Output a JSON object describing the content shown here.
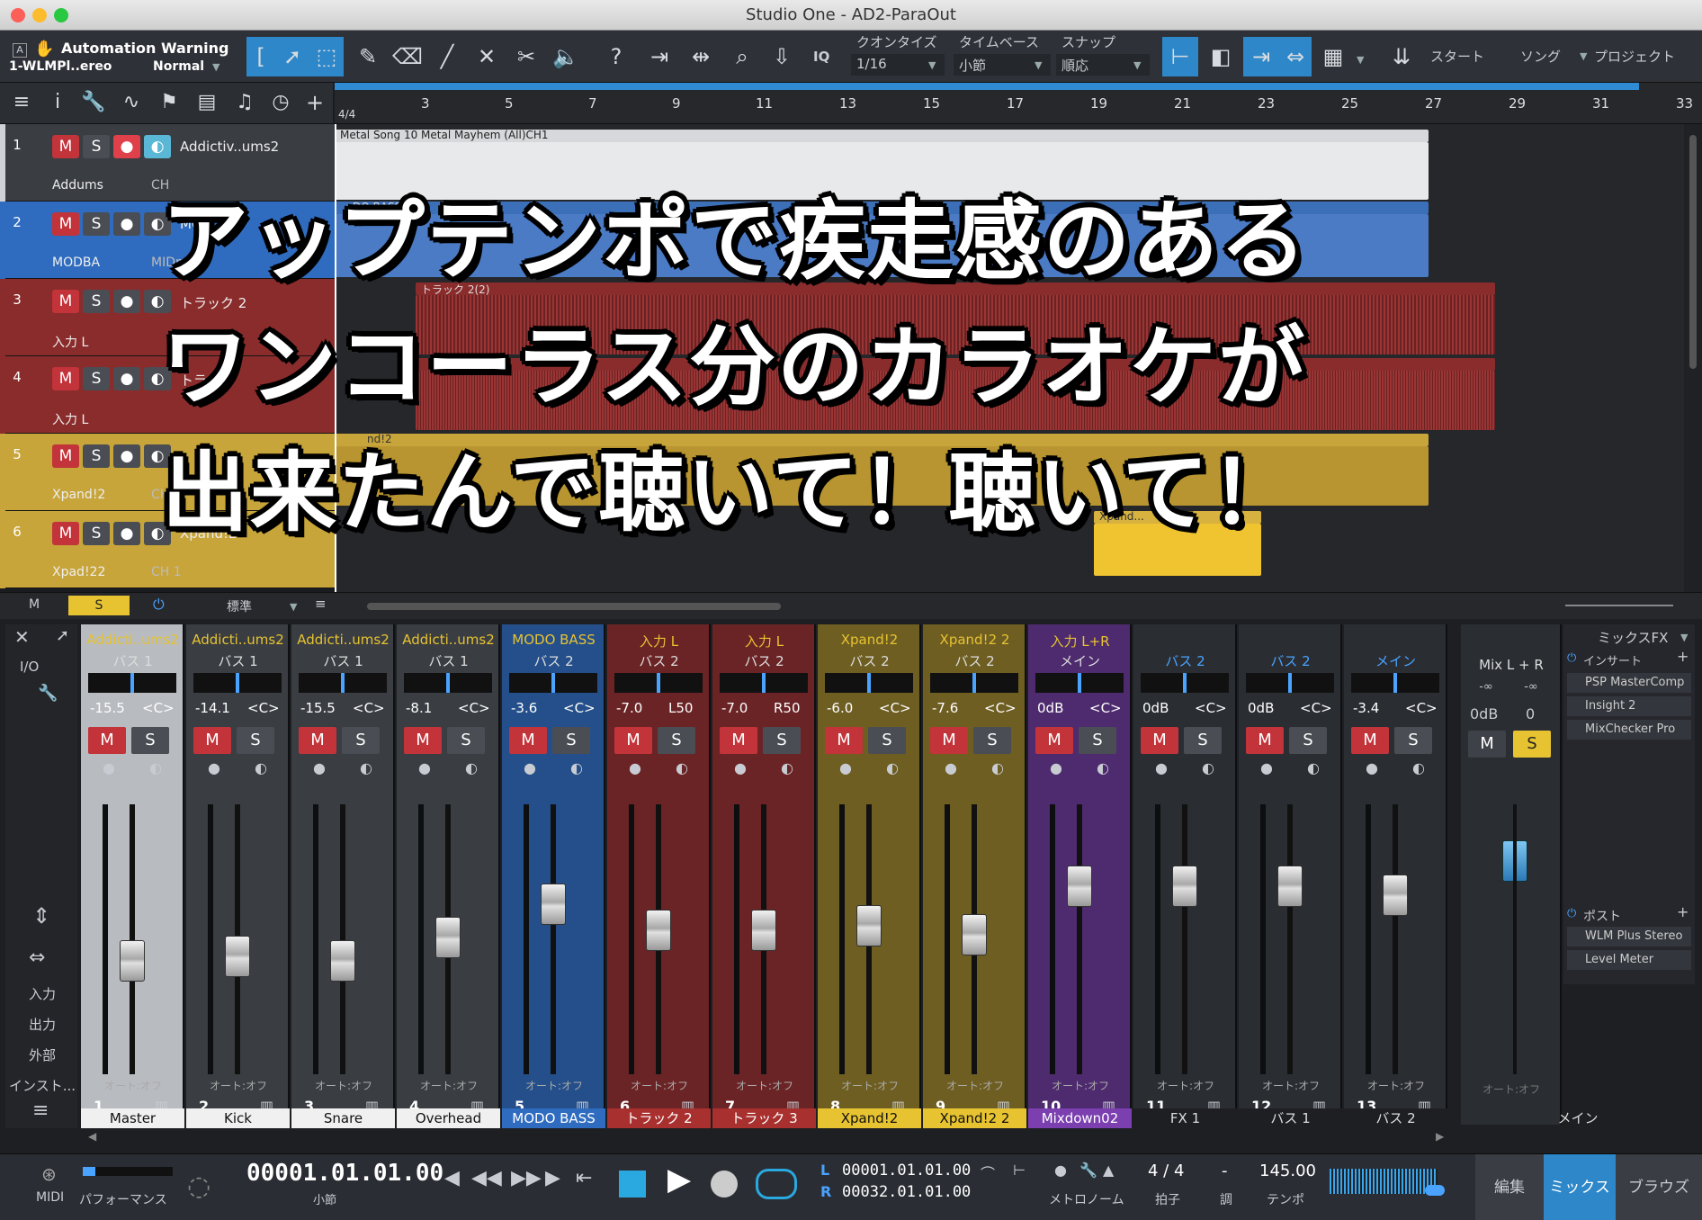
{
  "window": {
    "title": "Studio One - AD2-ParaOut"
  },
  "toolbar": {
    "automation_title": "Automation Warning",
    "automation_device": "1-WLMPl..ereo",
    "automation_mode": "Normal",
    "quantize_label": "クオンタイズ",
    "quantize_value": "1/16",
    "timebase_label": "タイムベース",
    "timebase_value": "小節",
    "snap_label": "スナップ",
    "snap_value": "順応",
    "iq": "IQ",
    "start": "スタート",
    "song": "ソング",
    "project": "プロジェクト"
  },
  "ruler": {
    "timesig": "4/4",
    "bars": [
      "3",
      "5",
      "7",
      "9",
      "11",
      "13",
      "15",
      "17",
      "19",
      "21",
      "23",
      "25",
      "27",
      "29",
      "31",
      "33"
    ]
  },
  "clips": {
    "song_title": "Metal Song 10 Metal Mayhem (All)CH1",
    "modo": "DO BASS",
    "track2": "トラック 2(2)",
    "track3": "3(2)",
    "xpand_a": "nd!2",
    "xpand_b": "Xpand..."
  },
  "tracks": [
    {
      "num": "1",
      "name": "Addictiv..ums2",
      "sub": "Addums",
      "ch": "CH",
      "color": "#cfd2d6"
    },
    {
      "num": "2",
      "name": "MO",
      "sub": "MODBA",
      "ch": "MIDput",
      "color": "#2f6cc0"
    },
    {
      "num": "3",
      "name": "トラック 2",
      "sub": "入力 L",
      "ch": "",
      "color": "#8a2c2c"
    },
    {
      "num": "4",
      "name": "トラ",
      "sub": "入力 L",
      "ch": "",
      "color": "#8a2c2c"
    },
    {
      "num": "5",
      "name": "",
      "sub": "Xpand!2",
      "ch": "CH",
      "color": "#c8a53a"
    },
    {
      "num": "6",
      "name": "Xpand!2",
      "sub": "Xpad!22",
      "ch": "CH 1",
      "color": "#c8a53a"
    }
  ],
  "track_footer": {
    "m": "M",
    "s": "S",
    "preset": "標準"
  },
  "overlay": {
    "line1": "アップテンポで疾走感のある",
    "line2": "ワンコーラス分のカラオケが",
    "line3": "出来たんで聴いて！聴いて！"
  },
  "mixer_left": {
    "io": "I/O",
    "input": "入力",
    "output": "出力",
    "external": "外部",
    "instrument": "インスト..."
  },
  "channels": [
    {
      "top": "Addicti..ums2",
      "bus": "バス 1",
      "vol": "-15.5",
      "pan": "<C>",
      "num": "1",
      "auto": "オート:オフ",
      "name": "Master",
      "color": "#b8bbbf",
      "name_bg": "#f0f0f0",
      "name_fg": "#111",
      "fader": 0.42
    },
    {
      "top": "Addicti..ums2",
      "bus": "バス 1",
      "vol": "-14.1",
      "pan": "<C>",
      "num": "2",
      "auto": "オート:オフ",
      "name": "Kick",
      "color": "#3a3d42",
      "name_bg": "#f0f0f0",
      "name_fg": "#111",
      "fader": 0.44
    },
    {
      "top": "Addicti..ums2",
      "bus": "バス 1",
      "vol": "-15.5",
      "pan": "<C>",
      "num": "3",
      "auto": "オート:オフ",
      "name": "Snare",
      "color": "#3a3d42",
      "name_bg": "#f0f0f0",
      "name_fg": "#111",
      "fader": 0.42
    },
    {
      "top": "Addicti..ums2",
      "bus": "バス 1",
      "vol": "-8.1",
      "pan": "<C>",
      "num": "4",
      "auto": "オート:オフ",
      "name": "Overhead",
      "color": "#3a3d42",
      "name_bg": "#f0f0f0",
      "name_fg": "#111",
      "fader": 0.52
    },
    {
      "top": "MODO BASS",
      "bus": "バス 2",
      "vol": "-3.6",
      "pan": "<C>",
      "num": "5",
      "auto": "オート:オフ",
      "name": "MODO BASS",
      "color": "#244f8a",
      "name_bg": "#2f6cc0",
      "name_fg": "#fff",
      "fader": 0.66
    },
    {
      "top": "入力 L",
      "bus": "バス 2",
      "vol": "-7.0",
      "pan": "L50",
      "num": "6",
      "auto": "オート:オフ",
      "name": "トラック 2",
      "color": "#6b2426",
      "name_bg": "#a8302f",
      "name_fg": "#fff",
      "fader": 0.55
    },
    {
      "top": "入力 L",
      "bus": "バス 2",
      "vol": "-7.0",
      "pan": "R50",
      "num": "7",
      "auto": "オート:オフ",
      "name": "トラック 3",
      "color": "#6b2426",
      "name_bg": "#a8302f",
      "name_fg": "#fff",
      "fader": 0.55
    },
    {
      "top": "Xpand!2",
      "bus": "バス 2",
      "vol": "-6.0",
      "pan": "<C>",
      "num": "8",
      "auto": "オート:オフ",
      "name": "Xpand!2",
      "color": "#6e5e22",
      "name_bg": "#e7c331",
      "name_fg": "#111",
      "fader": 0.57
    },
    {
      "top": "Xpand!2 2",
      "bus": "バス 2",
      "vol": "-7.6",
      "pan": "<C>",
      "num": "9",
      "auto": "オート:オフ",
      "name": "Xpand!2 2",
      "color": "#6e5e22",
      "name_bg": "#e7c331",
      "name_fg": "#111",
      "fader": 0.53
    },
    {
      "top": "入力 L+R",
      "bus": "メイン",
      "vol": "0dB",
      "pan": "<C>",
      "num": "10",
      "auto": "オート:オフ",
      "name": "Mixdown02",
      "color": "#4e2b6e",
      "name_bg": "#7b3fb0",
      "name_fg": "#fff",
      "fader": 0.74
    },
    {
      "top": "",
      "bus": "バス 2",
      "vol": "0dB",
      "pan": "<C>",
      "num": "11",
      "auto": "オート:オフ",
      "name": "FX 1",
      "color": "#2a2d32",
      "name_bg": "#1d1f23",
      "name_fg": "#ddd",
      "fader": 0.74
    },
    {
      "top": "",
      "bus": "バス 2",
      "vol": "0dB",
      "pan": "<C>",
      "num": "12",
      "auto": "オート:オフ",
      "name": "バス 1",
      "color": "#2a2d32",
      "name_bg": "#1d1f23",
      "name_fg": "#ddd",
      "fader": 0.74
    },
    {
      "top": "",
      "bus": "メイン",
      "vol": "-3.4",
      "pan": "<C>",
      "num": "13",
      "auto": "オート:オフ",
      "name": "バス 2",
      "color": "#2a2d32",
      "name_bg": "#1d1f23",
      "name_fg": "#ddd",
      "fader": 0.7
    }
  ],
  "main": {
    "top": "Mix L + R",
    "vol": "0dB",
    "pan": "0",
    "inf1": "-∞",
    "inf2": "-∞",
    "auto": "オート:オフ",
    "name": "メイン"
  },
  "mixfx": {
    "title": "ミックスFX",
    "insert": "インサート",
    "plugins": [
      "PSP MasterComp",
      "Insight 2",
      "MixChecker Pro"
    ],
    "post": "ポスト",
    "post_plugins": [
      "WLM Plus Stereo",
      "Level Meter"
    ]
  },
  "scale": [
    "10",
    "6",
    "0",
    "-6",
    "-12",
    "-24",
    "-36",
    "-48",
    "-72"
  ],
  "transport": {
    "midi": "MIDI",
    "performance": "パフォーマンス",
    "position": "00001.01.01.00",
    "pos_label": "小節",
    "l_label": "L",
    "l_value": "00001.01.01.00",
    "r_label": "R",
    "r_value": "00032.01.01.00",
    "metronome": "メトロノーム",
    "timesig": "4 / 4",
    "timesig_label": "拍子",
    "key": "-",
    "key_label": "調",
    "tempo": "145.00",
    "tempo_label": "テンポ",
    "edit": "編集",
    "mix": "ミックス",
    "browse": "ブラウズ"
  }
}
